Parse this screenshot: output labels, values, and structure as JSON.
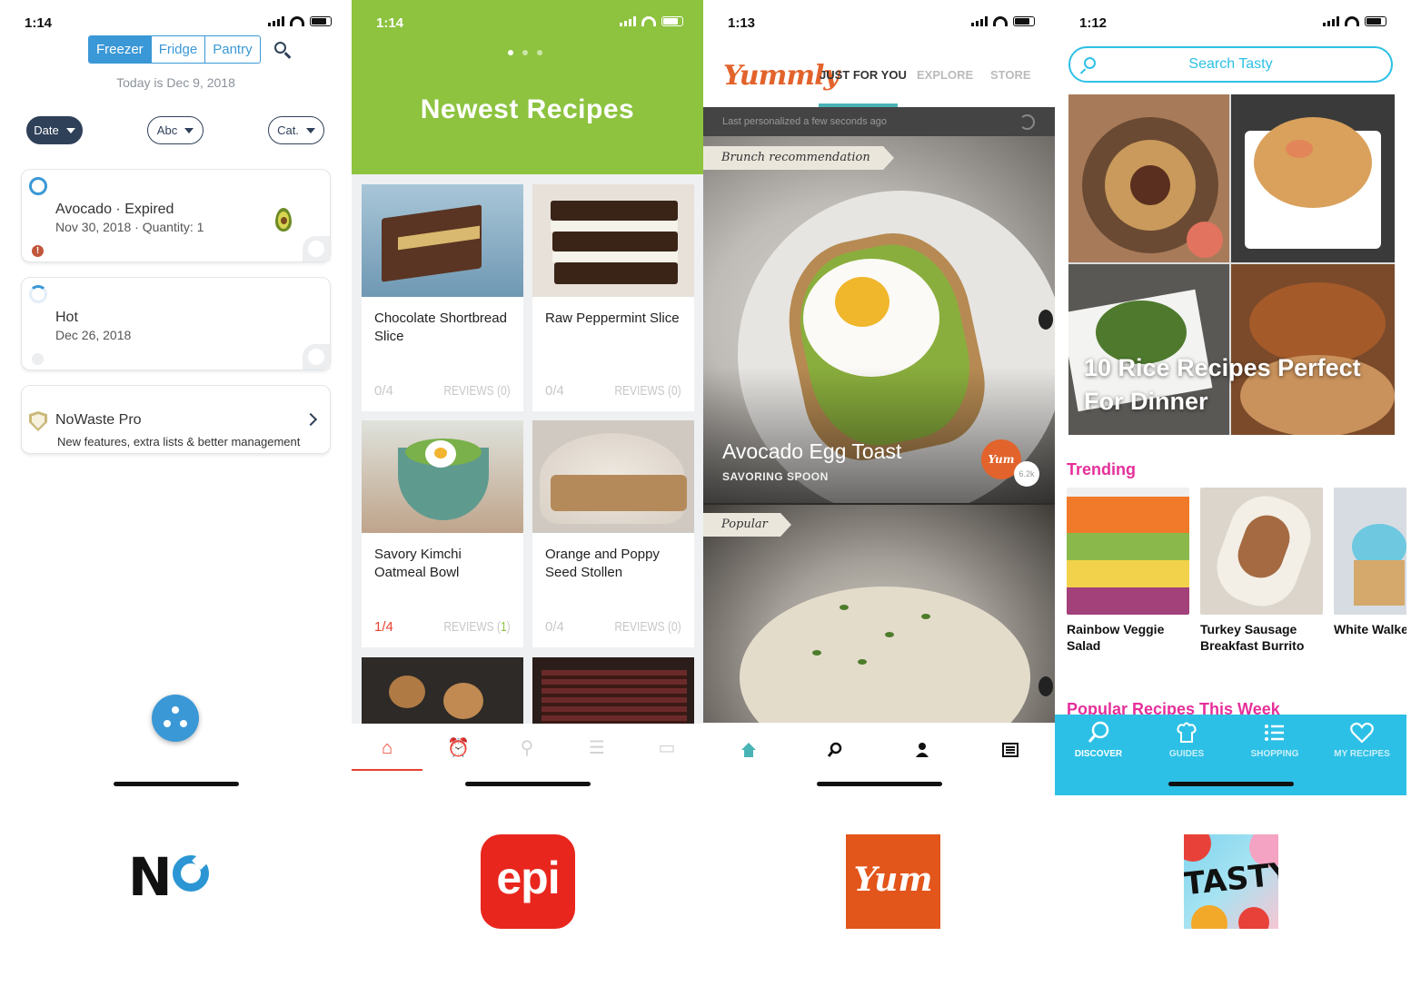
{
  "screens": {
    "nowaste": {
      "time": "1:14",
      "segments": [
        "Freezer",
        "Fridge",
        "Pantry"
      ],
      "today": "Today is Dec 9, 2018",
      "sort": [
        "Date",
        "Abc",
        "Cat."
      ],
      "items": [
        {
          "title": "Avocado · Expired",
          "subtitle": "Nov 30, 2018 · Quantity: 1"
        },
        {
          "title": "Hot",
          "subtitle": "Dec 26, 2018"
        }
      ],
      "promo": {
        "title": "NoWaste Pro",
        "subtitle": "New features, extra lists & better management"
      },
      "accent": "#3a98d6"
    },
    "epicurious": {
      "time": "1:14",
      "header": "Newest Recipes",
      "recipes": [
        {
          "name": "Chocolate Shortbread Slice",
          "rating": "0/4",
          "reviews": "REVIEWS (0)"
        },
        {
          "name": "Raw Peppermint Slice",
          "rating": "0/4",
          "reviews": "REVIEWS (0)"
        },
        {
          "name": "Savory Kimchi Oatmeal Bowl",
          "rating": "1/4",
          "reviews_label": "REVIEWS (",
          "reviews_count": "1",
          "reviews_close": ")"
        },
        {
          "name": "Orange and Poppy Seed Stollen",
          "rating": "0/4",
          "reviews": "REVIEWS (0)"
        }
      ],
      "accent": "#8dc33f",
      "tab_icons": [
        "home-icon",
        "alarm-icon",
        "search-icon",
        "list-icon",
        "pot-icon"
      ]
    },
    "yummly": {
      "time": "1:13",
      "logo": "Yummly",
      "tabs": [
        "JUST FOR YOU",
        "EXPLORE",
        "STORE"
      ],
      "personalized": "Last personalized a few seconds ago",
      "ribbon1": "Brunch recommendation",
      "hero_title": "Avocado Egg Toast",
      "hero_source": "SAVORING SPOON",
      "badge": "Yum",
      "yum_count": "6.2k",
      "ribbon2": "Popular",
      "accent": "#4ab3b5",
      "tab_icons": [
        "home-icon",
        "search-icon",
        "profile-icon",
        "list-icon"
      ]
    },
    "tasty": {
      "time": "1:12",
      "search_placeholder": "Search Tasty",
      "mosaic_title": "10 Rice Recipes Perfect For Dinner",
      "trending": "Trending",
      "trending_items": [
        "Rainbow Veggie Salad",
        "Turkey Sausage Breakfast Burrito",
        "White Walker Cupcakes"
      ],
      "popular": "Popular Recipes This Week",
      "tabs": [
        "DISCOVER",
        "GUIDES",
        "SHOPPING",
        "MY RECIPES"
      ],
      "accent": "#2dc0e6",
      "highlight": "#e5309a"
    }
  },
  "app_icons": {
    "epi": "epi",
    "yum": "Yum",
    "tasty": "TASTY"
  }
}
